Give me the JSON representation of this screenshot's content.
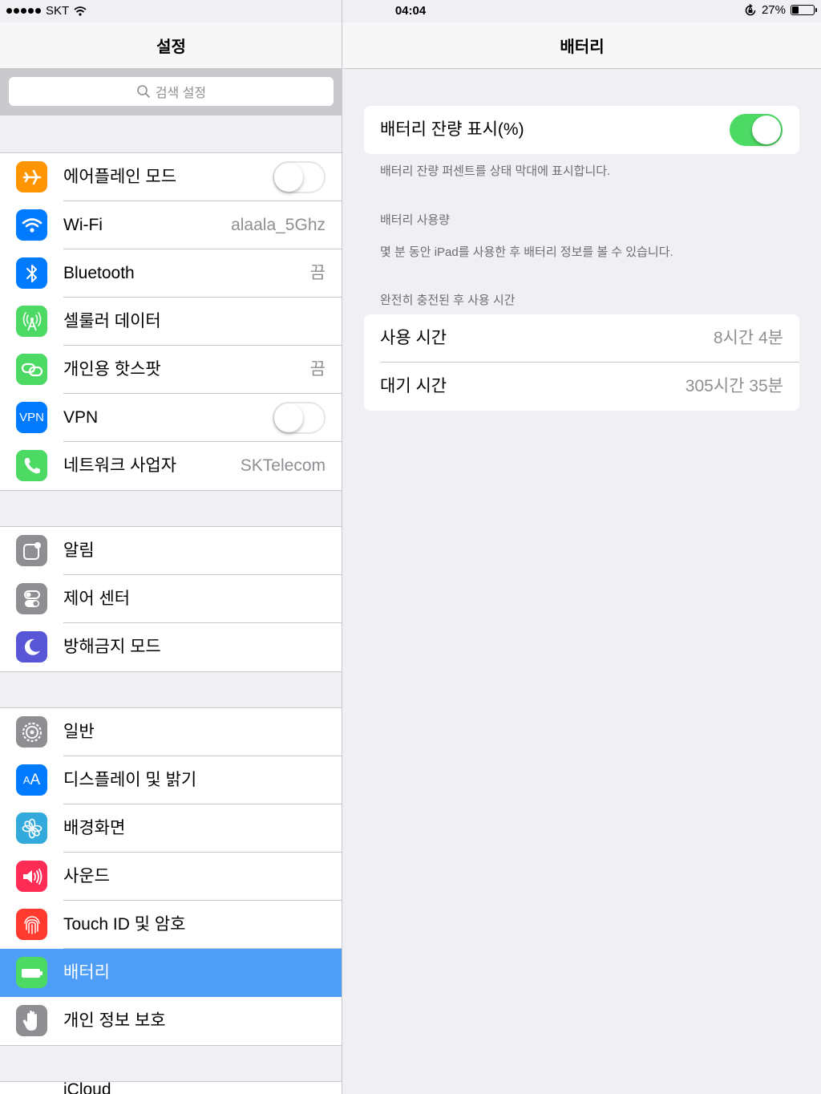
{
  "status_bar": {
    "carrier": "SKT",
    "time": "04:04",
    "battery_percent": "27%",
    "battery_level": 0.27
  },
  "left": {
    "title": "설정",
    "search_placeholder": "검색 설정",
    "group1": [
      {
        "label": "에어플레인 모드",
        "icon": "airplane-icon",
        "color": "#ff9500",
        "control": "switch",
        "on": false
      },
      {
        "label": "Wi-Fi",
        "icon": "wifi-icon",
        "color": "#007aff",
        "value": "alaala_5Ghz"
      },
      {
        "label": "Bluetooth",
        "icon": "bluetooth-icon",
        "color": "#007aff",
        "value": "끔"
      },
      {
        "label": "셀룰러 데이터",
        "icon": "cellular-antenna-icon",
        "color": "#4cd964"
      },
      {
        "label": "개인용 핫스팟",
        "icon": "hotspot-link-icon",
        "color": "#4cd964",
        "value": "끔"
      },
      {
        "label": "VPN",
        "icon": "vpn-icon",
        "icon_text": "VPN",
        "color": "#007aff",
        "control": "switch",
        "on": false
      },
      {
        "label": "네트워크 사업자",
        "icon": "phone-icon",
        "color": "#4cd964",
        "value": "SKTelecom"
      }
    ],
    "group2": [
      {
        "label": "알림",
        "icon": "notifications-icon",
        "color": "#8e8e93"
      },
      {
        "label": "제어 센터",
        "icon": "control-center-icon",
        "color": "#8e8e93"
      },
      {
        "label": "방해금지 모드",
        "icon": "moon-icon",
        "color": "#5856d6"
      }
    ],
    "group3": [
      {
        "label": "일반",
        "icon": "gear-icon",
        "color": "#8e8e93"
      },
      {
        "label": "디스플레이 및 밝기",
        "icon": "text-size-icon",
        "icon_text": "AA",
        "color": "#007aff"
      },
      {
        "label": "배경화면",
        "icon": "flower-icon",
        "color": "#34aadc"
      },
      {
        "label": "사운드",
        "icon": "speaker-icon",
        "color": "#ff2d55"
      },
      {
        "label": "Touch ID 및 암호",
        "icon": "fingerprint-icon",
        "color": "#ff3b30"
      },
      {
        "label": "배터리",
        "icon": "battery-icon",
        "color": "#4cd964",
        "selected": true
      },
      {
        "label": "개인 정보 보호",
        "icon": "hand-icon",
        "color": "#8e8e93"
      }
    ],
    "group4_partial": "iCloud"
  },
  "right": {
    "title": "배터리",
    "percent_toggle": {
      "label": "배터리 잔량 표시(%)",
      "on": true
    },
    "percent_footer": "배터리 잔량 퍼센트를 상태 막대에 표시합니다.",
    "usage_header": "배터리 사용량",
    "usage_footer": "몇 분 동안 iPad를 사용한 후 배터리 정보를 볼 수 있습니다.",
    "since_charge_header": "완전히 충전된 후 사용 시간",
    "usage_time": {
      "label": "사용 시간",
      "value": "8시간 4분"
    },
    "standby_time": {
      "label": "대기 시간",
      "value": "305시간 35분"
    }
  }
}
